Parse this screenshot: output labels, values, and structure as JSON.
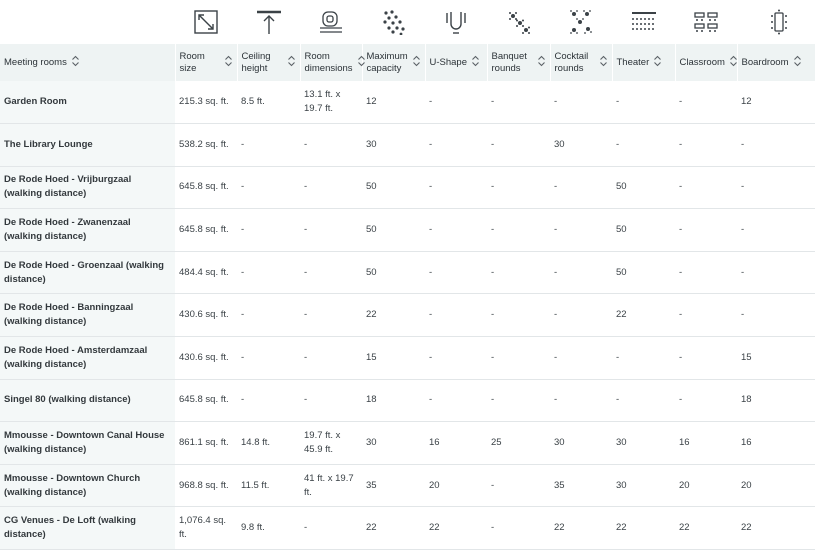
{
  "icons": [
    "room-size-icon",
    "ceiling-height-icon",
    "room-dimensions-icon",
    "maximum-capacity-icon",
    "u-shape-icon",
    "banquet-rounds-icon",
    "cocktail-rounds-icon",
    "theater-icon",
    "classroom-icon",
    "boardroom-icon"
  ],
  "colors": {
    "header_bg": "#eef3f3",
    "name_col_bg": "#f4f8f8",
    "text": "#333a3f",
    "icon": "#3b4247"
  },
  "headers": [
    "Meeting rooms",
    "Room size",
    "Ceiling height",
    "Room dimensions",
    "Maximum capacity",
    "U-Shape",
    "Banquet rounds",
    "Cocktail rounds",
    "Theater",
    "Classroom",
    "Boardroom"
  ],
  "rows": [
    {
      "cells": [
        "Garden Room",
        "215.3 sq. ft.",
        "8.5 ft.",
        "13.1 ft. x 19.7 ft.",
        "12",
        "-",
        "-",
        "-",
        "-",
        "-",
        "12"
      ]
    },
    {
      "cells": [
        "The Library Lounge",
        "538.2 sq. ft.",
        "-",
        "-",
        "30",
        "-",
        "-",
        "30",
        "-",
        "-",
        "-"
      ]
    },
    {
      "cells": [
        "De Rode Hoed - Vrijburgzaal (walking distance)",
        "645.8 sq. ft.",
        "-",
        "-",
        "50",
        "-",
        "-",
        "-",
        "50",
        "-",
        "-"
      ]
    },
    {
      "cells": [
        "De Rode Hoed - Zwanenzaal (walking distance)",
        "645.8 sq. ft.",
        "-",
        "-",
        "50",
        "-",
        "-",
        "-",
        "50",
        "-",
        "-"
      ]
    },
    {
      "cells": [
        "De Rode Hoed - Groenzaal (walking distance)",
        "484.4 sq. ft.",
        "-",
        "-",
        "50",
        "-",
        "-",
        "-",
        "50",
        "-",
        "-"
      ]
    },
    {
      "cells": [
        "De Rode Hoed - Banningzaal (walking distance)",
        "430.6 sq. ft.",
        "-",
        "-",
        "22",
        "-",
        "-",
        "-",
        "22",
        "-",
        "-"
      ]
    },
    {
      "cells": [
        "De Rode Hoed - Amsterdamzaal (walking distance)",
        "430.6 sq. ft.",
        "-",
        "-",
        "15",
        "-",
        "-",
        "-",
        "-",
        "-",
        "15"
      ]
    },
    {
      "cells": [
        "Singel 80 (walking distance)",
        "645.8 sq. ft.",
        "-",
        "-",
        "18",
        "-",
        "-",
        "-",
        "-",
        "-",
        "18"
      ]
    },
    {
      "cells": [
        "Mmousse - Downtown Canal House (walking distance)",
        "861.1 sq. ft.",
        "14.8 ft.",
        "19.7 ft. x 45.9 ft.",
        "30",
        "16",
        "25",
        "30",
        "30",
        "16",
        "16"
      ]
    },
    {
      "cells": [
        "Mmousse - Downtown Church (walking distance)",
        "968.8 sq. ft.",
        "11.5 ft.",
        "41 ft. x 19.7 ft.",
        "35",
        "20",
        "-",
        "35",
        "30",
        "20",
        "20"
      ]
    },
    {
      "cells": [
        "CG Venues - De Loft (walking distance)",
        "1,076.4 sq. ft.",
        "9.8 ft.",
        "-",
        "22",
        "22",
        "-",
        "22",
        "22",
        "22",
        "22"
      ]
    }
  ]
}
